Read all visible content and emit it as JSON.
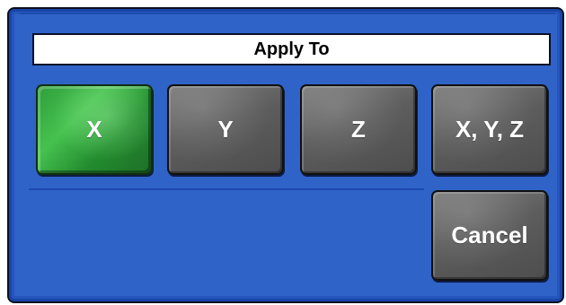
{
  "dialog": {
    "title": "Apply To",
    "buttons": {
      "x": "X",
      "y": "Y",
      "z": "Z",
      "xyz": "X, Y, Z",
      "cancel": "Cancel"
    },
    "selected": "X"
  },
  "colors": {
    "panel_background": "#2f63c7",
    "selected_button": "#2f9f3c",
    "button": "#5d5d5d",
    "title_background": "#ffffff",
    "text_on_button": "#ffffff"
  }
}
